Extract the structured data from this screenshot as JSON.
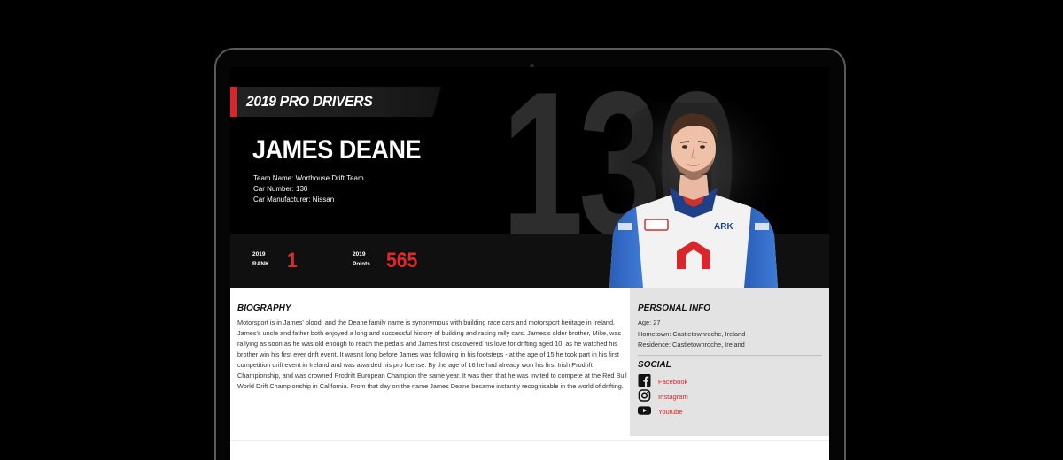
{
  "page": {
    "section_title": "2019 PRO DRIVERS",
    "background_number": "130"
  },
  "driver": {
    "name": "JAMES DEANE",
    "info": [
      "Team Name: Worthouse Drift Team",
      "Car Number: 130",
      "Car Manufacturer: Nissan"
    ]
  },
  "stats": {
    "rank": {
      "year": "2019",
      "label": "RANK",
      "value": "1"
    },
    "points": {
      "year": "2019",
      "label": "Points",
      "value": "565"
    }
  },
  "biography": {
    "heading": "BIOGRAPHY",
    "text": "Motorsport is in James' blood, and the Deane family name is synonymous with building race cars and motorsport heritage in Ireland. James's uncle and father both enjoyed a long and successful history of building and racing rally cars. James's older brother, Mike, was rallying as soon as he was old enough to reach the pedals and James first discovered his love for drifting aged 10, as he watched his brother win his first ever drift event. It wasn't long before James was following in his footsteps - at the age of 15 he took part in his first competition drift event in Ireland and was awarded his pro license. By the age of 16 he had already won his first Irish Prodrift Championship, and was crowned Prodrift European Champion the same year. It was then that he was invited to compete at the Red Bull World Drift Championship in California. From that day on the name James Deane became instantly recognisable in the world of drifting."
  },
  "personal_info": {
    "heading": "PERSONAL INFO",
    "age": "Age: 27",
    "hometown": "Hometown: Castletownroche, Ireland",
    "residence": "Residence: Castletownroche, Ireland"
  },
  "social": {
    "heading": "SOCIAL",
    "links": [
      {
        "icon": "facebook-icon",
        "label": "Facebook"
      },
      {
        "icon": "instagram-icon",
        "label": "Instagram"
      },
      {
        "icon": "youtube-icon",
        "label": "Youtube"
      }
    ]
  },
  "colors": {
    "accent": "#d8262b",
    "stat_value": "#e02a2a",
    "sidebar_bg": "#e3e3e3",
    "hero_bg": "#000000"
  }
}
